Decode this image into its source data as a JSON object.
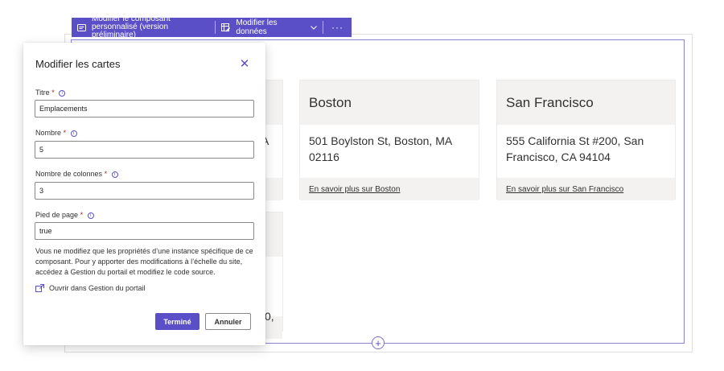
{
  "toolbar": {
    "edit_component_line1": "Modifier le composant",
    "edit_component_line2": "personnalisé (version préliminaire)",
    "edit_data_label": "Modifier les données",
    "more_label": "···"
  },
  "cards": [
    {
      "title": "Boston",
      "address": "501 Boylston St, Boston, MA 02116",
      "link": "En savoir plus sur Boston"
    },
    {
      "title": "San Francisco",
      "address": "555 California St #200, San Francisco, CA 94104",
      "link": "En savoir plus sur San Francisco"
    }
  ],
  "partial_cards": {
    "row1_fragment": "A",
    "row2_fragment": "0,"
  },
  "panel": {
    "title": "Modifier les cartes",
    "close_icon": "✕",
    "fields": [
      {
        "label": "Titre",
        "required": "*",
        "value": "Emplacements"
      },
      {
        "label": "Nombre",
        "required": "*",
        "value": "5"
      },
      {
        "label": "Nombre de colonnes",
        "required": "*",
        "value": "3"
      },
      {
        "label": "Pied de page",
        "required": "*",
        "value": "true"
      }
    ],
    "note": "Vous ne modifiez que les propriétés d’une instance spécifique de ce composant. Pour y apporter des modifications à l’échelle du site, accédez à Gestion du portail et modifiez le code source.",
    "open_link": "Ouvrir dans Gestion du portail",
    "done_label": "Terminé",
    "cancel_label": "Annuler"
  },
  "add_icon": "+"
}
